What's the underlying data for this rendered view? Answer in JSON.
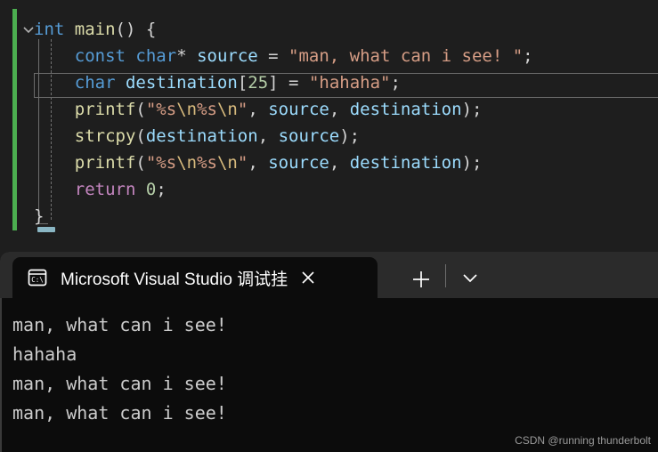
{
  "editor": {
    "name": "code-editor",
    "fold_toggle": "chevron-down-icon",
    "lines": [
      {
        "id": "line-1",
        "tokens": [
          {
            "t": "int",
            "c": "k-type"
          },
          {
            "t": " ",
            "c": "k-punc"
          },
          {
            "t": "main",
            "c": "k-fn"
          },
          {
            "t": "() {",
            "c": "k-punc"
          }
        ]
      },
      {
        "id": "line-2",
        "tokens": [
          {
            "t": "    ",
            "c": "k-punc"
          },
          {
            "t": "const",
            "c": "k-type"
          },
          {
            "t": " ",
            "c": "k-punc"
          },
          {
            "t": "char",
            "c": "k-type"
          },
          {
            "t": "* ",
            "c": "k-punc"
          },
          {
            "t": "source",
            "c": "k-var"
          },
          {
            "t": " = ",
            "c": "k-punc"
          },
          {
            "t": "\"man, what can i see! \"",
            "c": "k-str"
          },
          {
            "t": ";",
            "c": "k-punc"
          }
        ]
      },
      {
        "id": "line-3",
        "tokens": [
          {
            "t": "    ",
            "c": "k-punc"
          },
          {
            "t": "char",
            "c": "k-type"
          },
          {
            "t": " ",
            "c": "k-punc"
          },
          {
            "t": "destination",
            "c": "k-var"
          },
          {
            "t": "[",
            "c": "k-punc"
          },
          {
            "t": "25",
            "c": "k-num"
          },
          {
            "t": "] = ",
            "c": "k-punc"
          },
          {
            "t": "\"hahaha\"",
            "c": "k-str"
          },
          {
            "t": ";",
            "c": "k-punc"
          }
        ]
      },
      {
        "id": "line-4",
        "tokens": [
          {
            "t": "    ",
            "c": "k-punc"
          },
          {
            "t": "printf",
            "c": "k-fn"
          },
          {
            "t": "(",
            "c": "k-punc"
          },
          {
            "t": "\"%s",
            "c": "k-str"
          },
          {
            "t": "\\n",
            "c": "k-esc"
          },
          {
            "t": "%s",
            "c": "k-str"
          },
          {
            "t": "\\n",
            "c": "k-esc"
          },
          {
            "t": "\"",
            "c": "k-str"
          },
          {
            "t": ", ",
            "c": "k-punc"
          },
          {
            "t": "source",
            "c": "k-var"
          },
          {
            "t": ", ",
            "c": "k-punc"
          },
          {
            "t": "destination",
            "c": "k-var"
          },
          {
            "t": ");",
            "c": "k-punc"
          }
        ]
      },
      {
        "id": "line-5",
        "tokens": [
          {
            "t": "    ",
            "c": "k-punc"
          },
          {
            "t": "strcpy",
            "c": "k-fn"
          },
          {
            "t": "(",
            "c": "k-punc"
          },
          {
            "t": "destination",
            "c": "k-var"
          },
          {
            "t": ", ",
            "c": "k-punc"
          },
          {
            "t": "source",
            "c": "k-var"
          },
          {
            "t": ");",
            "c": "k-punc"
          }
        ]
      },
      {
        "id": "line-6",
        "tokens": [
          {
            "t": "    ",
            "c": "k-punc"
          },
          {
            "t": "printf",
            "c": "k-fn"
          },
          {
            "t": "(",
            "c": "k-punc"
          },
          {
            "t": "\"%s",
            "c": "k-str"
          },
          {
            "t": "\\n",
            "c": "k-esc"
          },
          {
            "t": "%s",
            "c": "k-str"
          },
          {
            "t": "\\n",
            "c": "k-esc"
          },
          {
            "t": "\"",
            "c": "k-str"
          },
          {
            "t": ", ",
            "c": "k-punc"
          },
          {
            "t": "source",
            "c": "k-var"
          },
          {
            "t": ", ",
            "c": "k-punc"
          },
          {
            "t": "destination",
            "c": "k-var"
          },
          {
            "t": ");",
            "c": "k-punc"
          }
        ]
      },
      {
        "id": "line-7",
        "tokens": [
          {
            "t": "    ",
            "c": "k-punc"
          },
          {
            "t": "return",
            "c": "k-key"
          },
          {
            "t": " ",
            "c": "k-punc"
          },
          {
            "t": "0",
            "c": "k-num"
          },
          {
            "t": ";",
            "c": "k-punc"
          }
        ]
      },
      {
        "id": "line-8",
        "tokens": [
          {
            "t": "}",
            "c": "k-punc"
          }
        ]
      }
    ],
    "highlighted_line_index": 2,
    "change_bar_color": "#4caf50"
  },
  "terminal": {
    "tab": {
      "icon": "console-cmd-icon",
      "title": "Microsoft Visual Studio 调试挂",
      "close_label": "close-icon"
    },
    "new_tab_label": "new-tab-icon",
    "dropdown_label": "chevron-down-icon",
    "output": [
      "man, what can i see!",
      "hahaha",
      "man, what can i see!",
      "man, what can i see!"
    ],
    "background_color": "#0c0c0c",
    "tabbar_color": "#2b2b2b"
  },
  "watermark": {
    "text": "CSDN @running thunderbolt"
  }
}
